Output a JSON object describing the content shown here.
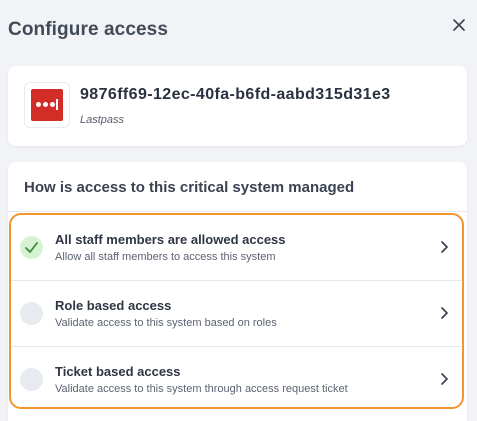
{
  "header": {
    "title": "Configure access",
    "close_icon": "close-icon"
  },
  "app": {
    "id": "9876ff69-12ec-40fa-b6fd-aabd315d31e3",
    "name": "Lastpass",
    "logo_icon": "lastpass-logo",
    "brand_color": "#d32d27"
  },
  "question": {
    "title": "How is access to this critical system managed"
  },
  "options": [
    {
      "title": "All staff members are allowed access",
      "description": "Allow all staff members to access this system",
      "selected": true
    },
    {
      "title": "Role based access",
      "description": "Validate access to this system based on roles",
      "selected": false
    },
    {
      "title": "Ticket based access",
      "description": "Validate access to this system through access request ticket",
      "selected": false
    }
  ],
  "colors": {
    "highlight_border": "#f0962e",
    "check_bg": "#d5f3d0",
    "check_mark": "#3a8a3a"
  }
}
